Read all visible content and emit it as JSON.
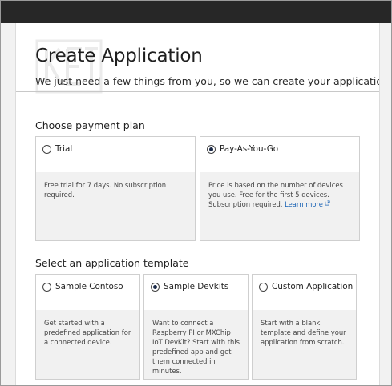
{
  "header": {
    "title": "Create Application",
    "subtitle": "We just need a few things from you, so we can create your application"
  },
  "payment": {
    "heading": "Choose payment plan",
    "plans": [
      {
        "label": "Trial",
        "selected": false,
        "description": "Free trial for 7 days. No subscription required."
      },
      {
        "label": "Pay-As-You-Go",
        "selected": true,
        "description": "Price is based on the number of devices you use. Free for the first 5 devices. Subscription required.",
        "link": "Learn more"
      }
    ]
  },
  "template": {
    "heading": "Select an application template",
    "options": [
      {
        "label": "Sample Contoso",
        "selected": false,
        "description": "Get started with a predefined application for a connected device."
      },
      {
        "label": "Sample Devkits",
        "selected": true,
        "description": "Want to connect a Raspberry PI or MXChip IoT DevKit? Start with this predefined app and get them connected in minutes."
      },
      {
        "label": "Custom Application",
        "selected": false,
        "description": "Start with a blank template and define your application from scratch."
      }
    ]
  },
  "icons": {
    "external_link": "external-link-icon"
  },
  "colors": {
    "accent_link": "#1a63b5",
    "radio_selected": "#1b2a48",
    "topbar": "#272727"
  }
}
